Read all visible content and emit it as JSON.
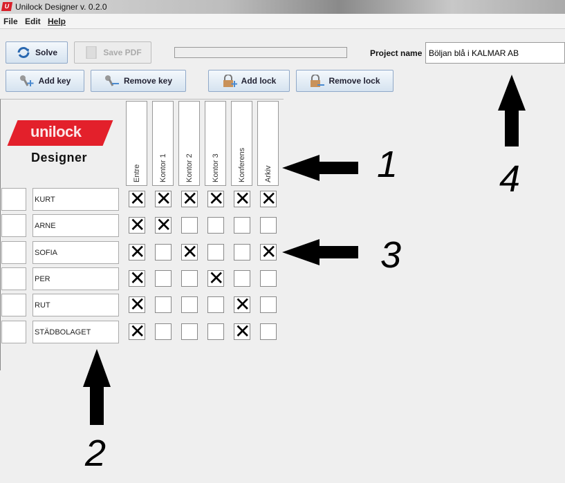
{
  "window": {
    "title": "Unilock Designer v. 0.2.0",
    "logo_letter": "U"
  },
  "menu": [
    "File",
    "Edit",
    "Help"
  ],
  "toolbar": {
    "solve": "Solve",
    "save_pdf": "Save PDF",
    "add_key": "Add key",
    "remove_key": "Remove key",
    "add_lock": "Add lock",
    "remove_lock": "Remove lock",
    "progress": 0
  },
  "project": {
    "label": "Project name",
    "value": "Böljan blå i KALMAR AB"
  },
  "brand": {
    "logo": "unilock",
    "subtitle": "Designer",
    "color": "#e3202b"
  },
  "locks": [
    "Entre",
    "Kontor 1",
    "Kontor 2",
    "Kontor 3",
    "Konferens",
    "Arkiv"
  ],
  "keys": [
    {
      "id": "",
      "name": "KURT",
      "access": [
        1,
        1,
        1,
        1,
        1,
        1
      ]
    },
    {
      "id": "",
      "name": "ARNE",
      "access": [
        1,
        1,
        0,
        0,
        0,
        0
      ]
    },
    {
      "id": "",
      "name": "SOFIA",
      "access": [
        1,
        0,
        1,
        0,
        0,
        1
      ]
    },
    {
      "id": "",
      "name": "PER",
      "access": [
        1,
        0,
        0,
        1,
        0,
        0
      ]
    },
    {
      "id": "",
      "name": "RUT",
      "access": [
        1,
        0,
        0,
        0,
        1,
        0
      ]
    },
    {
      "id": "",
      "name": "STÄDBOLAGET",
      "access": [
        1,
        0,
        0,
        0,
        1,
        0
      ]
    }
  ],
  "check_mark": "✕",
  "annotations": {
    "a1": "1",
    "a2": "2",
    "a3": "3",
    "a4": "4"
  }
}
